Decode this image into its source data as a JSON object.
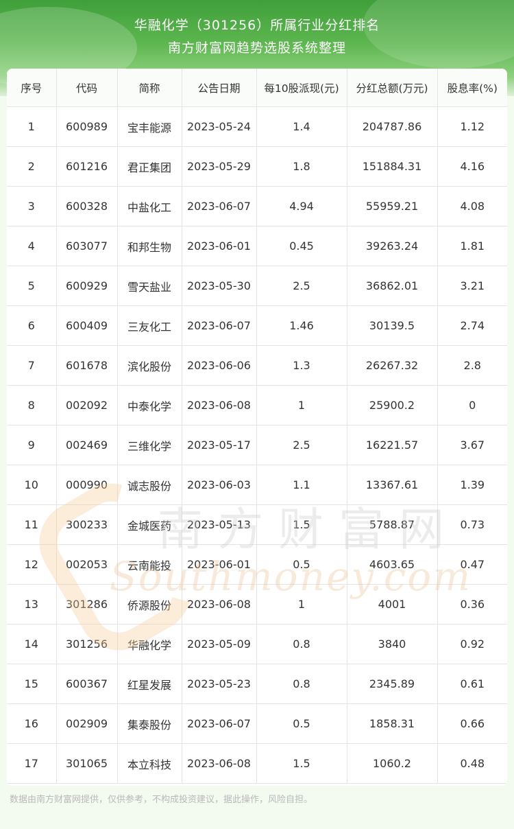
{
  "header": {
    "title": "华融化学（301256）所属行业分红排名",
    "subtitle": "南方财富网趋势选股系统整理"
  },
  "table": {
    "columns": [
      "序号",
      "代码",
      "简称",
      "公告日期",
      "每10股派现(元)",
      "分红总额(万元)",
      "股息率(%)"
    ],
    "rows": [
      [
        "1",
        "600989",
        "宝丰能源",
        "2023-05-24",
        "1.4",
        "204787.86",
        "1.12"
      ],
      [
        "2",
        "601216",
        "君正集团",
        "2023-05-29",
        "1.8",
        "151884.31",
        "4.16"
      ],
      [
        "3",
        "600328",
        "中盐化工",
        "2023-06-07",
        "4.94",
        "55959.21",
        "4.08"
      ],
      [
        "4",
        "603077",
        "和邦生物",
        "2023-06-01",
        "0.45",
        "39263.24",
        "1.81"
      ],
      [
        "5",
        "600929",
        "雪天盐业",
        "2023-05-30",
        "2.5",
        "36862.01",
        "3.21"
      ],
      [
        "6",
        "600409",
        "三友化工",
        "2023-06-07",
        "1.46",
        "30139.5",
        "2.74"
      ],
      [
        "7",
        "601678",
        "滨化股份",
        "2023-06-06",
        "1.3",
        "26267.32",
        "2.8"
      ],
      [
        "8",
        "002092",
        "中泰化学",
        "2023-06-08",
        "1",
        "25900.2",
        "0"
      ],
      [
        "9",
        "002469",
        "三维化学",
        "2023-05-17",
        "2.5",
        "16221.57",
        "3.67"
      ],
      [
        "10",
        "000990",
        "诚志股份",
        "2023-06-03",
        "1.1",
        "13367.61",
        "1.39"
      ],
      [
        "11",
        "300233",
        "金城医药",
        "2023-05-13",
        "1.5",
        "5788.87",
        "0.73"
      ],
      [
        "12",
        "002053",
        "云南能投",
        "2023-06-01",
        "0.5",
        "4603.65",
        "0.47"
      ],
      [
        "13",
        "301286",
        "侨源股份",
        "2023-06-08",
        "1",
        "4001",
        "0.36"
      ],
      [
        "14",
        "301256",
        "华融化学",
        "2023-05-09",
        "0.8",
        "3840",
        "0.92"
      ],
      [
        "15",
        "600367",
        "红星发展",
        "2023-05-23",
        "0.8",
        "2345.89",
        "0.61"
      ],
      [
        "16",
        "002909",
        "集泰股份",
        "2023-06-07",
        "0.5",
        "1858.31",
        "0.66"
      ],
      [
        "17",
        "301065",
        "本立科技",
        "2023-06-08",
        "1.5",
        "1060.2",
        "0.48"
      ]
    ]
  },
  "watermark": {
    "chinese": "南方财富网",
    "english": "Southmoney.com"
  },
  "footer": {
    "disclaimer": "数据由南方财富网提供，仅供参考，不构成投资建议，据此操作，风险自担。"
  },
  "colors": {
    "header_green": "#4caf45",
    "text": "#333333",
    "footer_text": "#b9b9b9"
  }
}
